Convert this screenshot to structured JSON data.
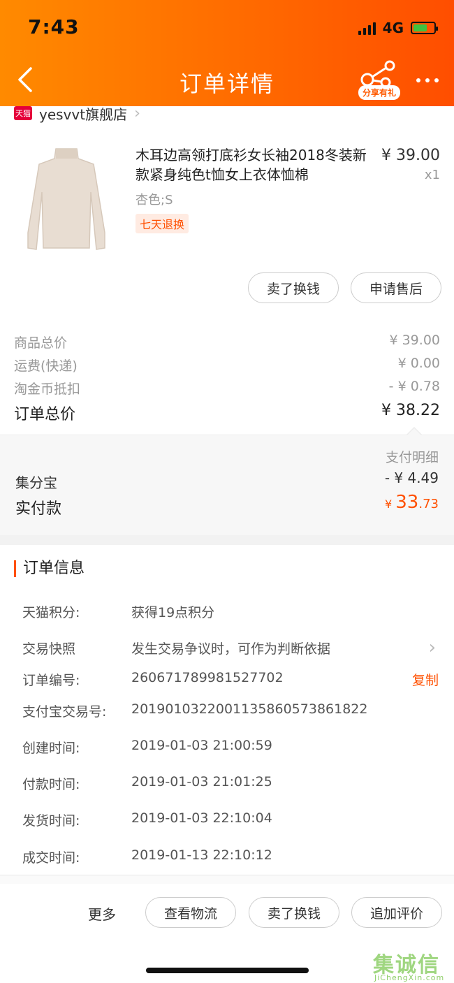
{
  "status_bar": {
    "time": "7:43",
    "network": "4G"
  },
  "nav": {
    "title": "订单详情",
    "share_badge": "分享有礼"
  },
  "store": {
    "logo_text": "天猫",
    "name": "yesvvt旗舰店"
  },
  "product": {
    "title": "木耳边高领打底衫女长袖2018冬装新款紧身纯色t恤女上衣体恤棉",
    "price": "¥ 39.00",
    "qty": "x1",
    "spec": "杏色;S",
    "tag": "七天退换"
  },
  "product_actions": {
    "sell": "卖了换钱",
    "after_sale": "申请售后"
  },
  "summary": [
    {
      "label": "商品总价",
      "value": "¥ 39.00"
    },
    {
      "label": "运费(快递)",
      "value": "¥ 0.00"
    },
    {
      "label": "淘金币抵扣",
      "value": "- ¥ 0.78"
    }
  ],
  "order_total": {
    "label": "订单总价",
    "value": "¥ 38.22"
  },
  "payment": {
    "detail_label": "支付明细",
    "jifenbao_label": "集分宝",
    "jifenbao_value": "- ¥ 4.49",
    "actual_label": "实付款",
    "actual_currency": "¥",
    "actual_int": "33",
    "actual_dec": ".73"
  },
  "order_info": {
    "title": "订单信息",
    "copy": "复制",
    "rows": [
      {
        "label": "天猫积分:",
        "value": "获得19点积分"
      },
      {
        "label": "交易快照",
        "value": "发生交易争议时，可作为判断依据"
      },
      {
        "label": "订单编号:",
        "value": "260671789981527702"
      },
      {
        "label": "支付宝交易号:",
        "value": "2019010322001135860573861822"
      },
      {
        "label": "创建时间:",
        "value": "2019-01-03 21:00:59"
      },
      {
        "label": "付款时间:",
        "value": "2019-01-03 21:01:25"
      },
      {
        "label": "发货时间:",
        "value": "2019-01-03 22:10:04"
      },
      {
        "label": "成交时间:",
        "value": "2019-01-13 22:10:12"
      }
    ]
  },
  "bottom_bar": {
    "more": "更多",
    "logistics": "查看物流",
    "sell": "卖了换钱",
    "review": "追加评价"
  },
  "watermark": {
    "chars": [
      "集",
      "诚",
      "信"
    ],
    "url": "JiChengXin.com"
  },
  "colors": {
    "accent": "#ff5000",
    "header_start": "#ff8a00",
    "header_end": "#ff4e00"
  }
}
